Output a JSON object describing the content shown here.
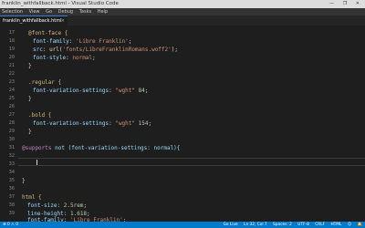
{
  "window": {
    "title": "franklin_withfallback.html - Visual Studio Code",
    "controls": "— ❐ ✕"
  },
  "menu": [
    "Selection",
    "View",
    "Go",
    "Debug",
    "Tasks",
    "Help"
  ],
  "tab": {
    "label": "franklin_withfallback.html",
    "close": "×"
  },
  "gutter": [
    "17",
    "18",
    "19",
    "20",
    "21",
    "22",
    "23",
    "24",
    "25",
    "26",
    "27",
    "28",
    "29",
    "30",
    "31",
    "32",
    "33",
    "34",
    "35",
    "36",
    "37",
    "38",
    "39",
    "40"
  ],
  "code": {
    "l17": "@font-face {",
    "l18_prop": "font-family",
    "l18_val": "'Libre Franklin'",
    "l19_prop": "src",
    "l19_fn": "url",
    "l19_val": "'fonts/LibreFranklinRomans.woff2'",
    "l20_prop": "font-style",
    "l20_val": "normal",
    "l23": ".regular {",
    "l24_prop": "font-variation-settings",
    "l24_str": "\"wght\"",
    "l24_num": "84",
    "l27": ".bold {",
    "l28_prop": "font-variation-settings",
    "l28_str": "\"wght\"",
    "l28_num": "154",
    "l32_kw": "@supports",
    "l32_rest": "not (font-variation-settings: normal){",
    "l38": "html {",
    "l39_prop": "font-size",
    "l39_num": "2.5rem",
    "l40_prop": "line-height",
    "l40_num": "1.618",
    "l41_prop": "font-family",
    "l41_val": "'Libre Franklin'"
  },
  "status": {
    "left": "⊗ 0  ⚠ 0",
    "items": [
      "Go Live",
      "Ln 32, Col 7",
      "Spaces: 2",
      "UTF-8",
      "CRLF",
      "HTML",
      "☺",
      "🔔"
    ]
  },
  "colors": {
    "editor_bg": "#1e1e1e",
    "statusbar": "#007acc",
    "selector": "#d7ba7d",
    "property": "#9cdcfe",
    "string": "#ce9178",
    "number": "#b5cea8",
    "keyword": "#c586c0"
  }
}
